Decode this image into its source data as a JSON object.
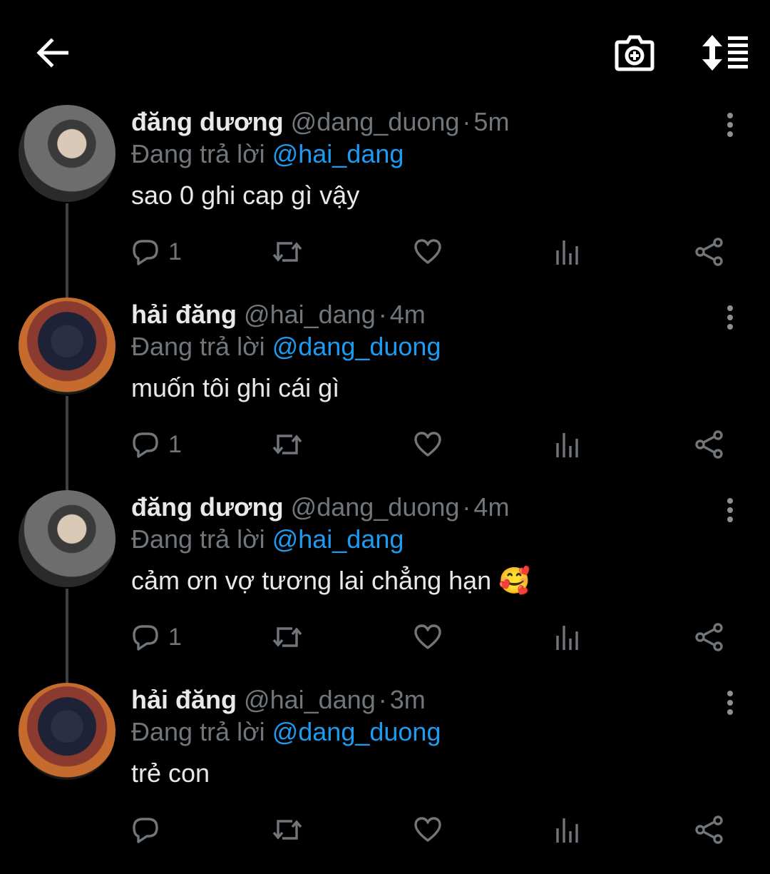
{
  "tweets": [
    {
      "name": "đăng dương",
      "handle": "@dang_duong",
      "time": "5m",
      "replying_prefix": "Đang trả lời",
      "replying_to": "@hai_dang",
      "text": "sao 0 ghi cap gì vậy",
      "reply_count": "1"
    },
    {
      "name": "hải đăng",
      "handle": "@hai_dang",
      "time": "4m",
      "replying_prefix": "Đang trả lời",
      "replying_to": "@dang_duong",
      "text": "muốn tôi ghi cái gì",
      "reply_count": "1"
    },
    {
      "name": "đăng dương",
      "handle": "@dang_duong",
      "time": "4m",
      "replying_prefix": "Đang trả lời",
      "replying_to": "@hai_dang",
      "text": "cảm ơn vợ tương lai chẳng hạn 🥰",
      "reply_count": "1"
    },
    {
      "name": "hải đăng",
      "handle": "@hai_dang",
      "time": "3m",
      "replying_prefix": "Đang trả lời",
      "replying_to": "@dang_duong",
      "text": "trẻ con",
      "reply_count": ""
    }
  ],
  "icons": {
    "back": "back-arrow-icon",
    "camera": "camera-add-icon",
    "sort": "sort-icon",
    "more": "more-vertical-icon",
    "reply": "reply-icon",
    "retweet": "retweet-icon",
    "like": "heart-icon",
    "stats": "analytics-icon",
    "share": "share-icon"
  },
  "colors": {
    "background": "#000000",
    "text": "#e7e9ea",
    "muted": "#71767b",
    "mention": "#1d9bf0",
    "thread_line": "#3e4144"
  },
  "dot_separator": "·"
}
